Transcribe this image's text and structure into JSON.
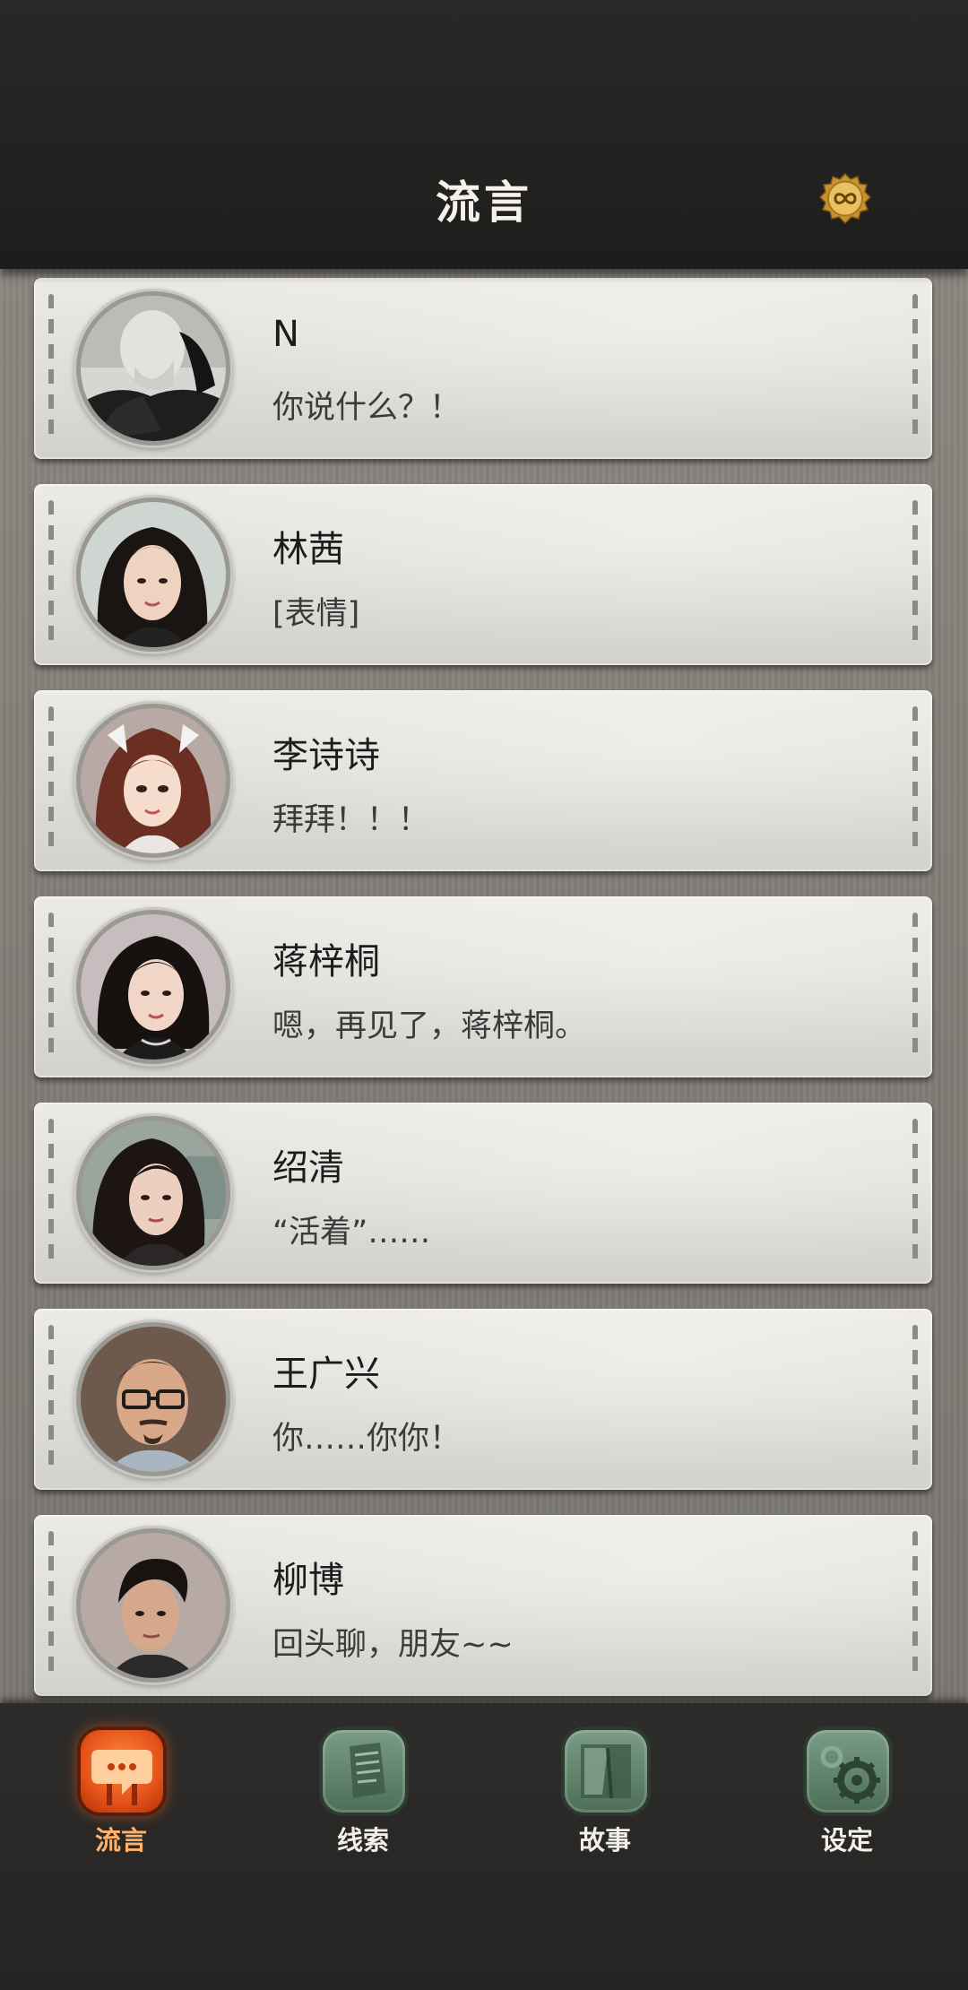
{
  "header": {
    "title": "流言",
    "coin_icon": "infinity-coin-icon"
  },
  "conversations": [
    {
      "name": "N",
      "message": "你说什么？！",
      "avatar": "avatar-n"
    },
    {
      "name": "林茜",
      "message": "[表情]",
      "avatar": "avatar-lin-qian"
    },
    {
      "name": "李诗诗",
      "message": "拜拜！！！",
      "avatar": "avatar-li-shishi"
    },
    {
      "name": "蒋梓桐",
      "message": "嗯，再见了，蒋梓桐。",
      "avatar": "avatar-jiang-zitong"
    },
    {
      "name": "绍清",
      "message": "“活着”……",
      "avatar": "avatar-shao-qing"
    },
    {
      "name": "王广兴",
      "message": "你……你你！",
      "avatar": "avatar-wang-guangxing"
    },
    {
      "name": "柳博",
      "message": "回头聊，朋友~~",
      "avatar": "avatar-liu-bo"
    }
  ],
  "bottom_nav": {
    "items": [
      {
        "label": "流言",
        "icon": "chat-bubble-icon",
        "active": true
      },
      {
        "label": "线索",
        "icon": "clue-paper-icon",
        "active": false
      },
      {
        "label": "故事",
        "icon": "book-icon",
        "active": false
      },
      {
        "label": "设定",
        "icon": "gear-icon",
        "active": false
      }
    ]
  },
  "colors": {
    "header_bg": "#232120",
    "card_bg": "#e3e2de",
    "nav_active": "#e4531a",
    "nav_inactive": "#5f8268"
  }
}
